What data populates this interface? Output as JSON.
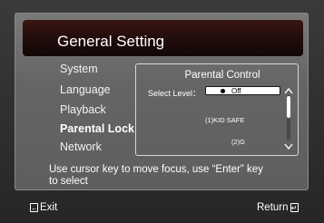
{
  "header": {
    "title": "General Setting"
  },
  "menu": {
    "items": [
      {
        "label": "System"
      },
      {
        "label": "Language"
      },
      {
        "label": "Playback"
      },
      {
        "label": "Parental Lock"
      },
      {
        "label": "Network"
      }
    ],
    "selected": "Parental Lock"
  },
  "parental": {
    "title": "Parental Control",
    "select_label": "Select Level：",
    "current_value": "Off",
    "options": [
      "(1)KID SAFE",
      "(2)G"
    ]
  },
  "hint": {
    "line1": "Use cursor key to move focus, use  “Enter”  key",
    "line2": "to select"
  },
  "footer": {
    "exit_label": "Exit",
    "return_label": "Return"
  },
  "icons": {
    "exit": "exit-key-icon",
    "return": "return-key-icon",
    "scroll_up": "chevron-up-icon",
    "scroll_down": "chevron-down-icon",
    "bullet": "bullet-icon"
  }
}
